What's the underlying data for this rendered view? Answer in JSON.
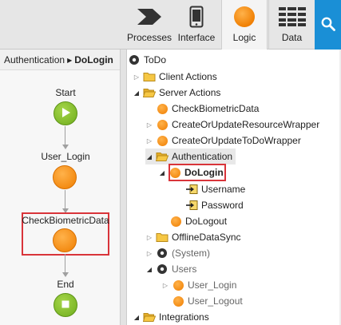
{
  "toolbar": {
    "tabs": [
      {
        "label": "Processes",
        "icon": "processes-chevron-icon"
      },
      {
        "label": "Interface",
        "icon": "mobile-device-icon"
      },
      {
        "label": "Logic",
        "icon": "logic-orange-circle-icon",
        "active": true
      },
      {
        "label": "Data",
        "icon": "data-table-icon"
      }
    ],
    "search_icon": "search-icon"
  },
  "flow": {
    "breadcrumb": {
      "parent": "Authentication",
      "separator": "▶",
      "current": "DoLogin"
    },
    "nodes": [
      {
        "label": "Start",
        "type": "start"
      },
      {
        "label": "User_Login",
        "type": "action"
      },
      {
        "label": "CheckBiometricData",
        "type": "action",
        "highlighted": true
      },
      {
        "label": "End",
        "type": "end"
      }
    ]
  },
  "tree": {
    "items": [
      {
        "label": "ToDo",
        "icon": "module-icon",
        "expander": ""
      },
      {
        "label": "Client Actions",
        "icon": "folder-icon",
        "expander": "▷"
      },
      {
        "label": "Server Actions",
        "icon": "folder-open-icon",
        "expander": "◢"
      },
      {
        "label": "CheckBiometricData",
        "icon": "server-action-icon",
        "expander": ""
      },
      {
        "label": "CreateOrUpdateResourceWrapper",
        "icon": "server-action-icon",
        "expander": "▷"
      },
      {
        "label": "CreateOrUpdateToDoWrapper",
        "icon": "server-action-icon",
        "expander": "▷"
      },
      {
        "label": "Authentication",
        "icon": "folder-open-icon",
        "expander": "◢"
      },
      {
        "label": "DoLogin",
        "icon": "server-action-icon",
        "expander": "◢",
        "selected": true
      },
      {
        "label": "Username",
        "icon": "input-parameter-icon",
        "expander": ""
      },
      {
        "label": "Password",
        "icon": "input-parameter-icon",
        "expander": ""
      },
      {
        "label": "DoLogout",
        "icon": "server-action-icon",
        "expander": ""
      },
      {
        "label": "OfflineDataSync",
        "icon": "folder-icon",
        "expander": "▷"
      },
      {
        "label": "(System)",
        "icon": "reference-module-icon",
        "expander": "▷"
      },
      {
        "label": "Users",
        "icon": "reference-module-icon",
        "expander": "◢"
      },
      {
        "label": "User_Login",
        "icon": "server-action-icon",
        "expander": "▷"
      },
      {
        "label": "User_Logout",
        "icon": "server-action-icon",
        "expander": ""
      },
      {
        "label": "Integrations",
        "icon": "folder-open-icon",
        "expander": "◢"
      }
    ]
  },
  "colors": {
    "accent_blue": "#1a8fd6",
    "orange": "#ef7d00",
    "green": "#6eac1c",
    "highlight_red": "#d9343a"
  }
}
